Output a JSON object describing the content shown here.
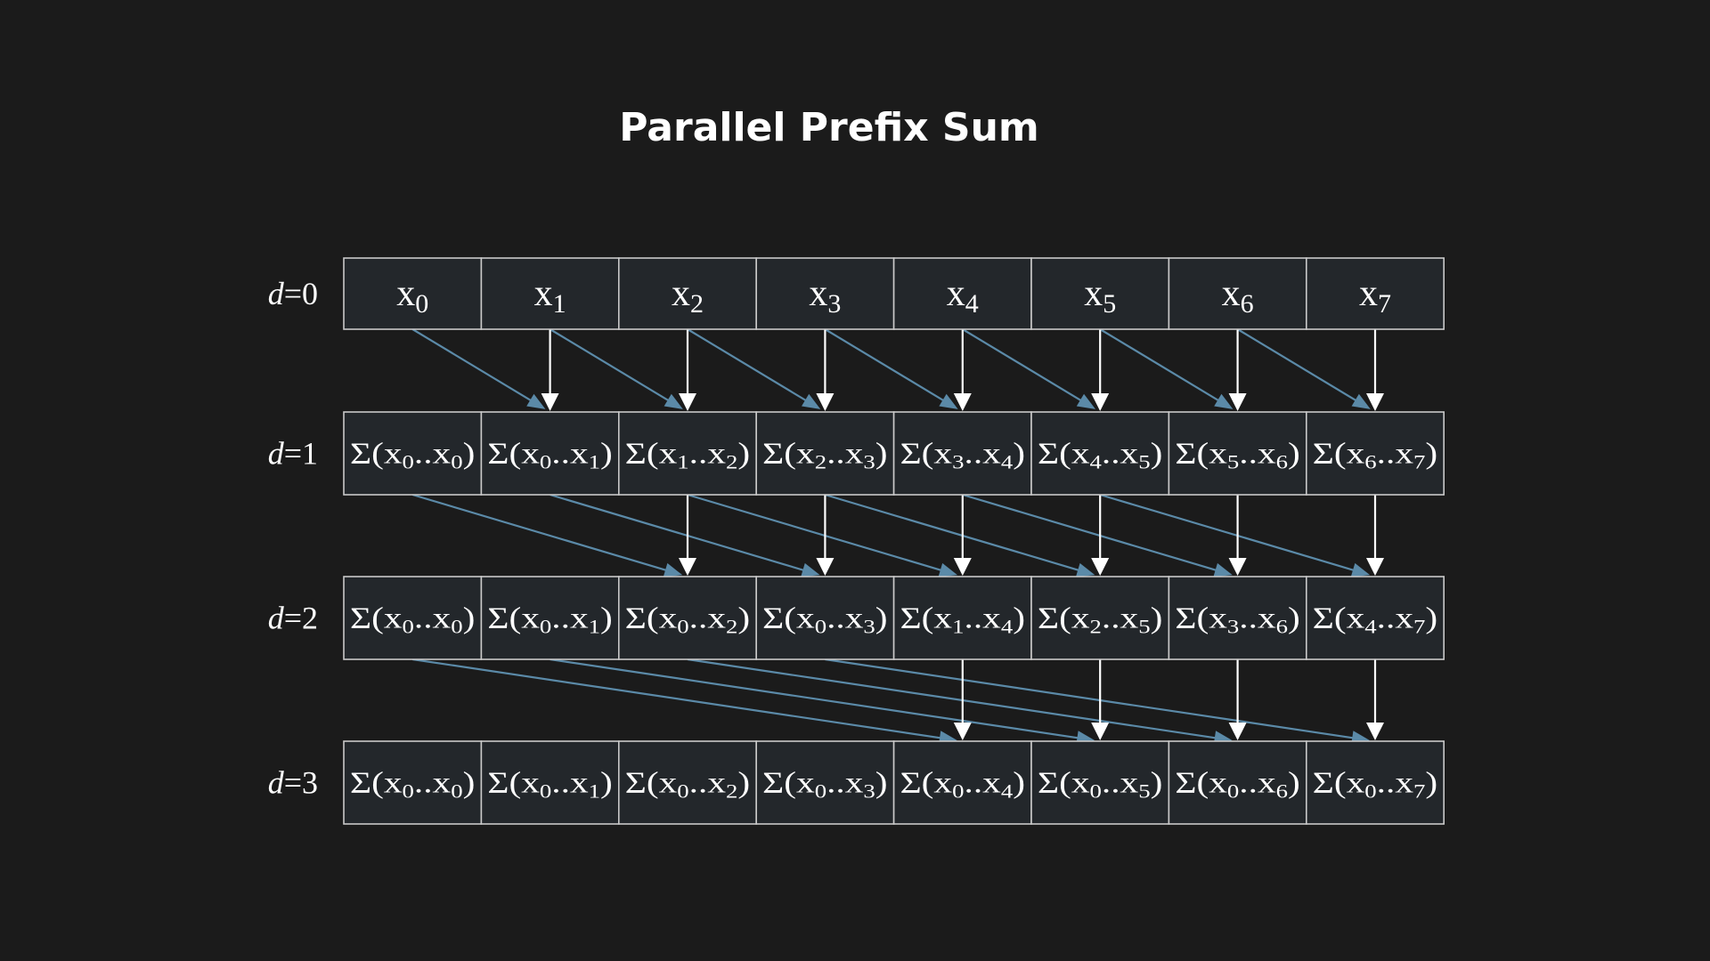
{
  "title": "Parallel Prefix Sum",
  "rows": [
    {
      "label": {
        "var": "d",
        "rest": "=0"
      },
      "cells": [
        {
          "pre": "x",
          "sub": "0"
        },
        {
          "pre": "x",
          "sub": "1"
        },
        {
          "pre": "x",
          "sub": "2"
        },
        {
          "pre": "x",
          "sub": "3"
        },
        {
          "pre": "x",
          "sub": "4"
        },
        {
          "pre": "x",
          "sub": "5"
        },
        {
          "pre": "x",
          "sub": "6"
        },
        {
          "pre": "x",
          "sub": "7"
        }
      ]
    },
    {
      "label": {
        "var": "d",
        "rest": "=1"
      },
      "cells": [
        {
          "pre": "Σ(x",
          "a": "0",
          "mid": "..x",
          "b": "0",
          "post": ")"
        },
        {
          "pre": "Σ(x",
          "a": "0",
          "mid": "..x",
          "b": "1",
          "post": ")"
        },
        {
          "pre": "Σ(x",
          "a": "1",
          "mid": "..x",
          "b": "2",
          "post": ")"
        },
        {
          "pre": "Σ(x",
          "a": "2",
          "mid": "..x",
          "b": "3",
          "post": ")"
        },
        {
          "pre": "Σ(x",
          "a": "3",
          "mid": "..x",
          "b": "4",
          "post": ")"
        },
        {
          "pre": "Σ(x",
          "a": "4",
          "mid": "..x",
          "b": "5",
          "post": ")"
        },
        {
          "pre": "Σ(x",
          "a": "5",
          "mid": "..x",
          "b": "6",
          "post": ")"
        },
        {
          "pre": "Σ(x",
          "a": "6",
          "mid": "..x",
          "b": "7",
          "post": ")"
        }
      ]
    },
    {
      "label": {
        "var": "d",
        "rest": "=2"
      },
      "cells": [
        {
          "pre": "Σ(x",
          "a": "0",
          "mid": "..x",
          "b": "0",
          "post": ")"
        },
        {
          "pre": "Σ(x",
          "a": "0",
          "mid": "..x",
          "b": "1",
          "post": ")"
        },
        {
          "pre": "Σ(x",
          "a": "0",
          "mid": "..x",
          "b": "2",
          "post": ")"
        },
        {
          "pre": "Σ(x",
          "a": "0",
          "mid": "..x",
          "b": "3",
          "post": ")"
        },
        {
          "pre": "Σ(x",
          "a": "1",
          "mid": "..x",
          "b": "4",
          "post": ")"
        },
        {
          "pre": "Σ(x",
          "a": "2",
          "mid": "..x",
          "b": "5",
          "post": ")"
        },
        {
          "pre": "Σ(x",
          "a": "3",
          "mid": "..x",
          "b": "6",
          "post": ")"
        },
        {
          "pre": "Σ(x",
          "a": "4",
          "mid": "..x",
          "b": "7",
          "post": ")"
        }
      ]
    },
    {
      "label": {
        "var": "d",
        "rest": "=3"
      },
      "cells": [
        {
          "pre": "Σ(x",
          "a": "0",
          "mid": "..x",
          "b": "0",
          "post": ")"
        },
        {
          "pre": "Σ(x",
          "a": "0",
          "mid": "..x",
          "b": "1",
          "post": ")"
        },
        {
          "pre": "Σ(x",
          "a": "0",
          "mid": "..x",
          "b": "2",
          "post": ")"
        },
        {
          "pre": "Σ(x",
          "a": "0",
          "mid": "..x",
          "b": "3",
          "post": ")"
        },
        {
          "pre": "Σ(x",
          "a": "0",
          "mid": "..x",
          "b": "4",
          "post": ")"
        },
        {
          "pre": "Σ(x",
          "a": "0",
          "mid": "..x",
          "b": "5",
          "post": ")"
        },
        {
          "pre": "Σ(x",
          "a": "0",
          "mid": "..x",
          "b": "6",
          "post": ")"
        },
        {
          "pre": "Σ(x",
          "a": "0",
          "mid": "..x",
          "b": "7",
          "post": ")"
        }
      ]
    }
  ],
  "edges": [
    {
      "from_row": 0,
      "to_row": 1,
      "offset": 1
    },
    {
      "from_row": 1,
      "to_row": 2,
      "offset": 2
    },
    {
      "from_row": 2,
      "to_row": 3,
      "offset": 4
    }
  ],
  "colors": {
    "background": "#1b1b1b",
    "cell_fill": "#23272b",
    "cell_border": "#c9c9c9",
    "text": "#ffffff",
    "shifted_edge": "#5b8aa8",
    "vertical_edge": "#ffffff"
  }
}
